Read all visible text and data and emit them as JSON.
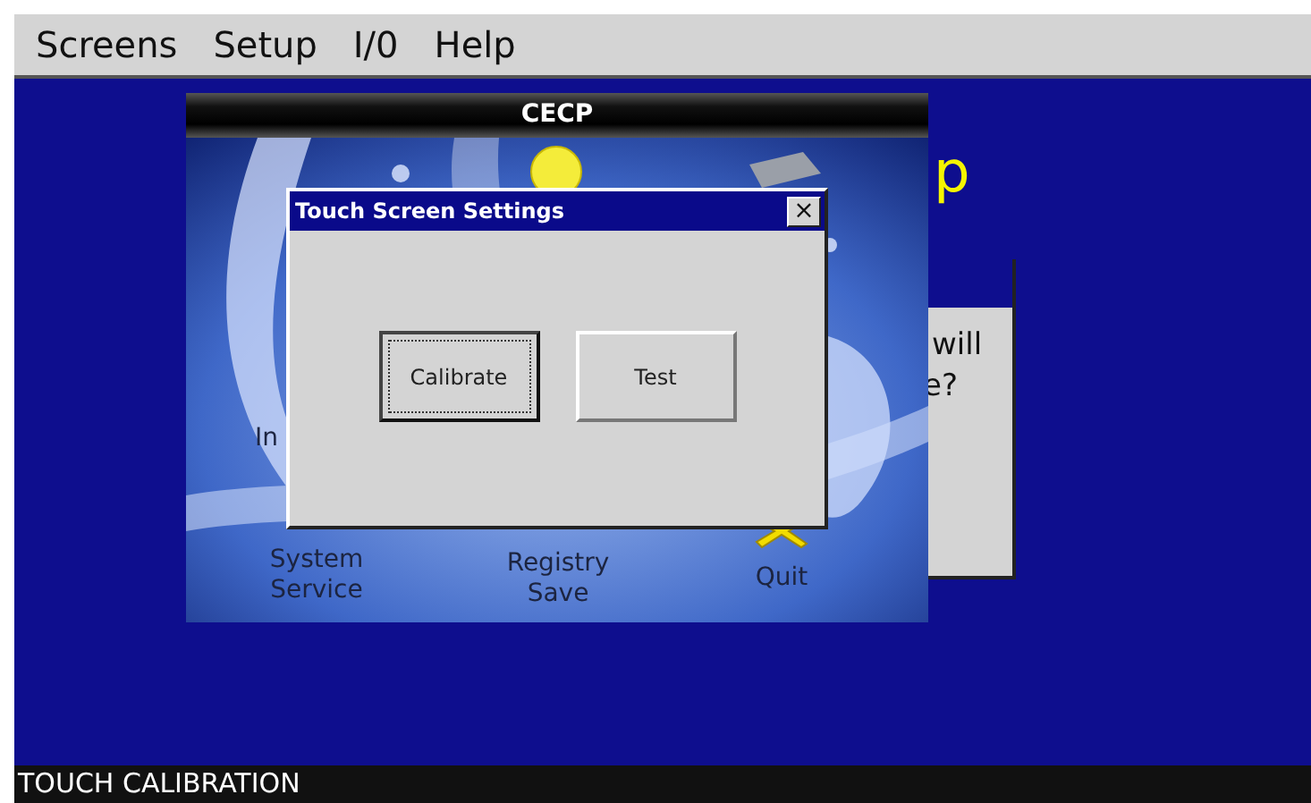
{
  "menu": [
    {
      "label": "Screens"
    },
    {
      "label": "Setup"
    },
    {
      "label": "I/0"
    },
    {
      "label": "Help"
    }
  ],
  "background_dialog": {
    "heading": "p",
    "lines": [
      "will",
      "e?"
    ]
  },
  "cecp_window": {
    "title": "CECP",
    "items": [
      {
        "label": "In"
      },
      {
        "label": "System\nService"
      },
      {
        "label": "Registry\nSave"
      },
      {
        "label": "Quit"
      }
    ]
  },
  "dialog": {
    "title": "Touch Screen Settings",
    "close": "×",
    "buttons": [
      {
        "label": "Calibrate",
        "focused": true
      },
      {
        "label": "Test",
        "focused": false
      }
    ]
  },
  "status_bar": "TOUCH CALIBRATION"
}
